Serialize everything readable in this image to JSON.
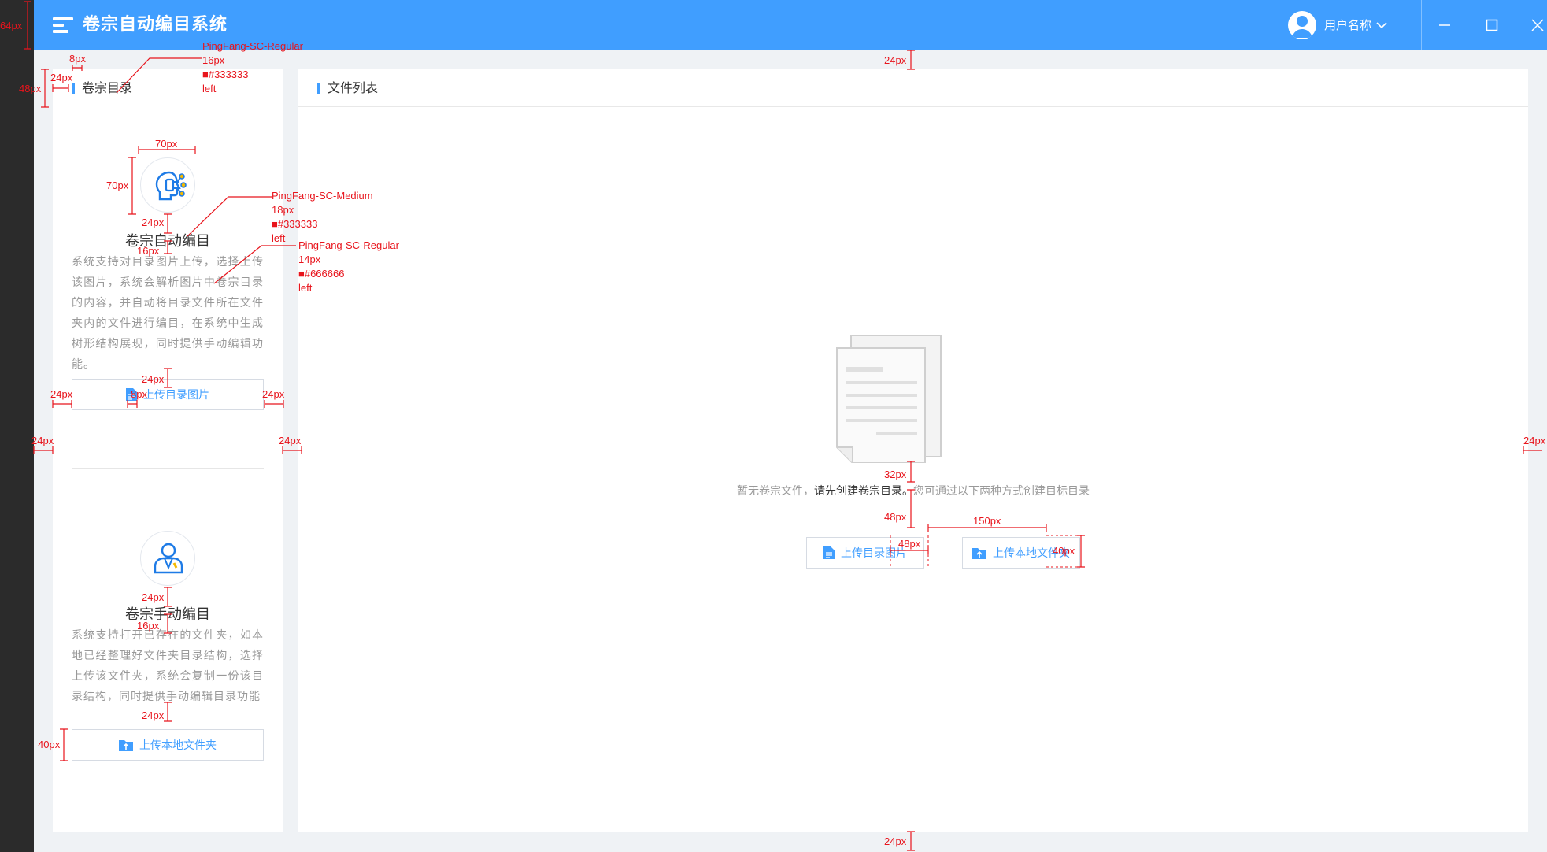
{
  "header": {
    "app_title": "卷宗自动编目系统",
    "user_name": "用户名称",
    "colors": {
      "bar": "#409eff",
      "text": "#ffffff"
    },
    "icons": [
      "menu-icon",
      "user-avatar-icon",
      "chevron-down-icon",
      "minimize-icon",
      "maximize-icon",
      "close-icon"
    ]
  },
  "left_panel": {
    "title": "卷宗目录",
    "auto": {
      "title": "卷宗自动编目",
      "desc": "系统支持对目录图片上传，选择上传该图片，系统会解析图片中卷宗目录的内容，并自动将目录文件所在文件夹内的文件进行编目，在系统中生成树形结构展现，同时提供手动编辑功能。",
      "button": "上传目录图片"
    },
    "manual": {
      "title": "卷宗手动编目",
      "desc": "系统支持打开已存在的文件夹，如本地已经整理好文件夹目录结构，选择上传该文件夹，系统会复制一份该目录结构，同时提供手动编辑目录功能",
      "button": "上传本地文件夹"
    }
  },
  "right_panel": {
    "title": "文件列表",
    "empty_text_a": "暂无卷宗文件，",
    "empty_text_b": "请先创建卷宗目录。",
    "empty_text_c": "您可通过以下两种方式创建目标目录",
    "btn_upload_image": "上传目录图片",
    "btn_upload_folder": "上传本地文件夹"
  },
  "annotations": {
    "font1": [
      "PingFang-SC-Regular",
      "16px",
      "■#333333",
      "left"
    ],
    "font2": [
      "PingFang-SC-Medium",
      "18px",
      "■#333333",
      "left"
    ],
    "font3": [
      "PingFang-SC-Regular",
      "14px",
      "■#666666",
      "left"
    ],
    "dims": {
      "h64": "64px",
      "w8": "8px",
      "w24": "24px",
      "h48": "48px",
      "w70": "70px",
      "h70": "70px",
      "h16": "16px",
      "h32": "32px",
      "w150": "150px",
      "h40": "40px"
    }
  }
}
